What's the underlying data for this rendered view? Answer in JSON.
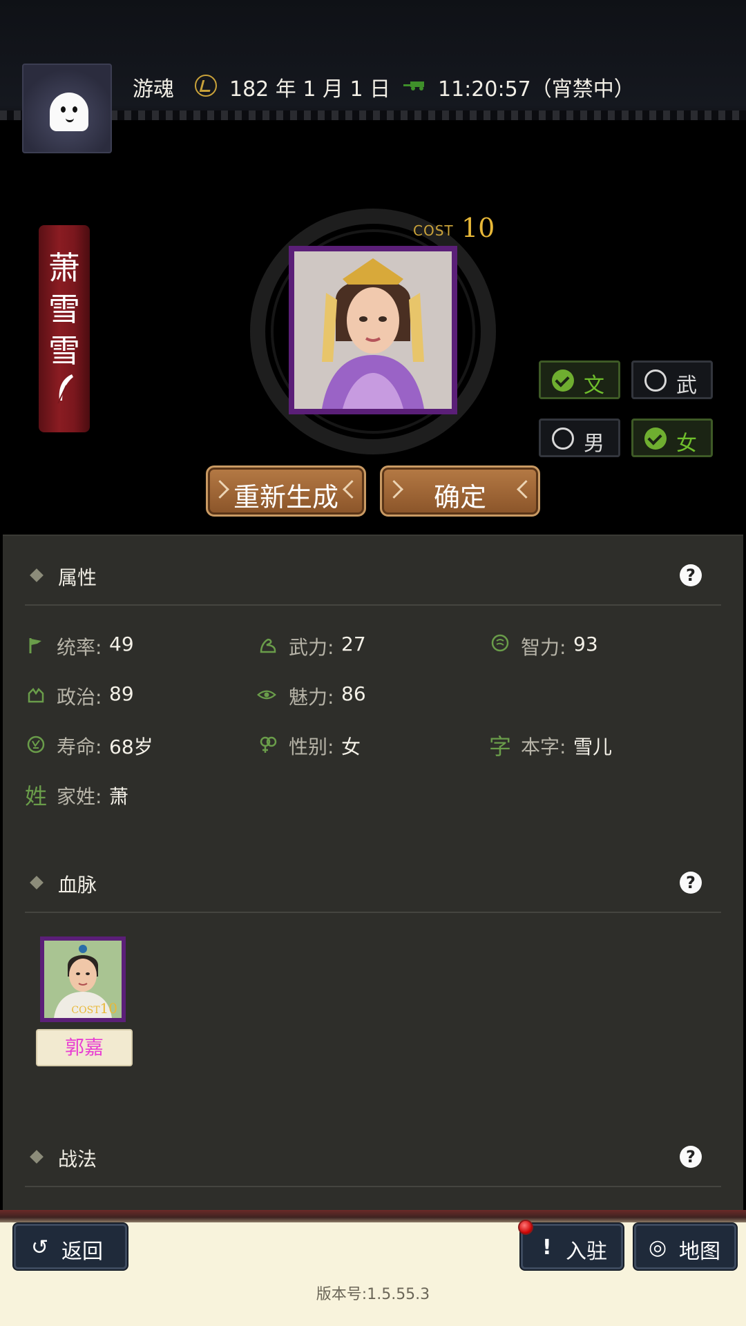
{
  "header": {
    "player_name": "游魂",
    "date": "182 年 1 月 1 日",
    "time": "11:20:57（宵禁中）",
    "clock_icon": "clock-icon",
    "carriage_icon": "carriage-icon"
  },
  "character": {
    "name_chars": [
      "萧",
      "雪",
      "雪"
    ],
    "cost_label": "COST",
    "cost_value": "10",
    "options": {
      "wen": {
        "label": "文",
        "checked": true
      },
      "wu": {
        "label": "武",
        "checked": false
      },
      "male": {
        "label": "男",
        "checked": false
      },
      "female": {
        "label": "女",
        "checked": true
      }
    },
    "regenerate_label": "重新生成",
    "confirm_label": "确定"
  },
  "attributes": {
    "title": "属性",
    "help": "?",
    "items": [
      {
        "label": "统率:",
        "value": "49",
        "icon": "flag-icon"
      },
      {
        "label": "武力:",
        "value": "27",
        "icon": "arm-icon"
      },
      {
        "label": "智力:",
        "value": "93",
        "icon": "brain-icon"
      },
      {
        "label": "政治:",
        "value": "89",
        "icon": "politics-icon"
      },
      {
        "label": "魅力:",
        "value": "86",
        "icon": "eye-icon"
      },
      {
        "label": "寿命:",
        "value": "68岁",
        "icon": "lifespan-icon"
      },
      {
        "label": "性别:",
        "value": "女",
        "icon": "gender-icon"
      },
      {
        "label": "本字:",
        "value": "雪儿",
        "icon_char": "字"
      },
      {
        "label": "家姓:",
        "value": "萧",
        "icon_char": "姓"
      }
    ]
  },
  "bloodline": {
    "title": "血脉",
    "help": "?",
    "child": {
      "name": "郭嘉",
      "cost_label": "COST",
      "cost_value": "10"
    }
  },
  "tactics": {
    "title": "战法",
    "help": "?"
  },
  "bottom": {
    "back_label": "返回",
    "station_label": "入驻",
    "map_label": "地图",
    "version": "版本号:1.5.55.3"
  },
  "colors": {
    "accent_green": "#6fbf2c",
    "banner_red": "#8a1c22",
    "portrait_border": "#5b1f78",
    "cost_gold": "#e8b838",
    "name_pink": "#e83fd2"
  }
}
